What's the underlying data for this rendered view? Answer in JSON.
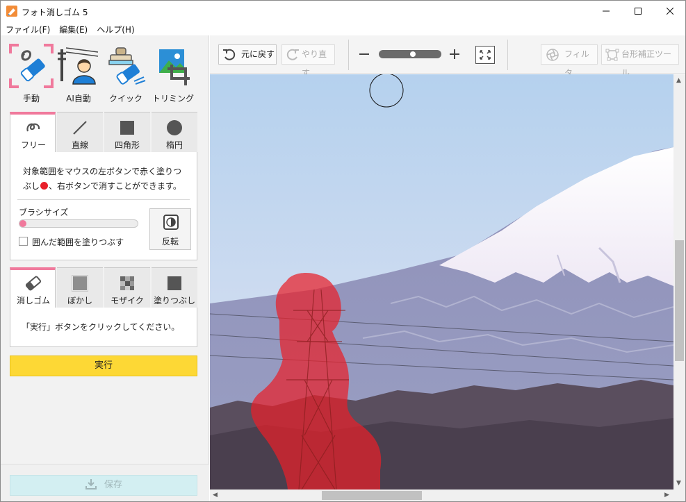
{
  "window": {
    "title": "フォト消しゴム 5",
    "controls": [
      "minimize",
      "maximize",
      "close"
    ]
  },
  "menu": [
    "ファイル(F)",
    "編集(E)",
    "ヘルプ(H)"
  ],
  "modes": [
    {
      "label": "手動",
      "icon": "eraser-icon",
      "selected": true
    },
    {
      "label": "AI自動",
      "icon": "person-powerline-icon",
      "selected": false
    },
    {
      "label": "クイック",
      "icon": "stamp-eraser-icon",
      "selected": false
    },
    {
      "label": "トリミング",
      "icon": "crop-icon",
      "selected": false
    }
  ],
  "draw_tabs": [
    {
      "label": "フリー",
      "icon": "freehand-icon",
      "active": true
    },
    {
      "label": "直線",
      "icon": "line-icon",
      "active": false
    },
    {
      "label": "四角形",
      "icon": "square-icon",
      "active": false
    },
    {
      "label": "楕円",
      "icon": "circle-icon",
      "active": false
    }
  ],
  "draw_panel": {
    "description_1": "対象範囲をマウスの左ボタンで赤く塗りつぶし",
    "description_2": "、右ボタンで消すことができます。",
    "brush_label": "ブラシサイズ",
    "brush_level": 0.0,
    "fill_enclosed_label": "囲んだ範囲を塗りつぶす",
    "fill_enclosed_checked": false,
    "invert_label": "反転"
  },
  "effect_tabs": [
    {
      "label": "消しゴム",
      "icon": "eraser-icon",
      "active": true
    },
    {
      "label": "ぼかし",
      "icon": "blur-icon",
      "active": false
    },
    {
      "label": "モザイク",
      "icon": "mosaic-icon",
      "active": false
    },
    {
      "label": "塗りつぶし",
      "icon": "fill-square-icon",
      "active": false
    }
  ],
  "effect_panel": {
    "description": "「実行」ボタンをクリックしてください。"
  },
  "run_label": "実行",
  "save_label": "保存",
  "toolbar": {
    "undo_label": "元に戻す",
    "redo_label": "やり直す",
    "zoom_level": 0.55,
    "filter_label": "フィルタ",
    "keystone_label": "台形補正ツール"
  },
  "colors": {
    "accent_pink": "#f0799c",
    "run_yellow": "#fdd835",
    "save_disabled": "#d3eff2",
    "mask_red": "#e8202a"
  }
}
